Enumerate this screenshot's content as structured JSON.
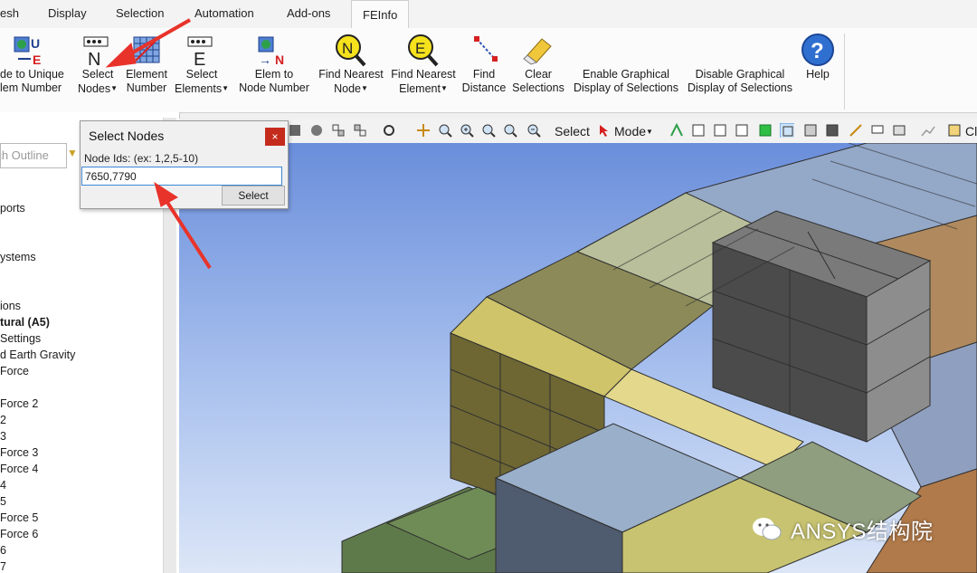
{
  "tabs": [
    "esh",
    "Display",
    "Selection",
    "Automation",
    "Add-ons",
    "FEInfo"
  ],
  "ribbon": {
    "node_to_unique_elem": [
      "de to Unique",
      "lem Number"
    ],
    "select_nodes": [
      "Select",
      "Nodes"
    ],
    "element_number": [
      "Element",
      "Number"
    ],
    "select_elements": [
      "Select",
      "Elements"
    ],
    "elem_to_node_number": [
      "Elem to",
      "Node Number"
    ],
    "find_nearest_node": [
      "Find Nearest",
      "Node"
    ],
    "find_nearest_element": [
      "Find Nearest",
      "Element"
    ],
    "find_distance": [
      "Find",
      "Distance"
    ],
    "clear_selections": [
      "Clear",
      "Selections"
    ],
    "enable_graphical": [
      "Enable Graphical",
      "Display of Selections"
    ],
    "disable_graphical": [
      "Disable Graphical",
      "Display of Selections"
    ],
    "help": "Help"
  },
  "outline": {
    "search_placeholder": "rch Outline",
    "items": [
      "ports",
      "ystems",
      "ions",
      "tural (A5)",
      "Settings",
      "d Earth Gravity",
      "Force",
      "Force 2",
      "2",
      "3",
      "Force 3",
      "Force 4",
      "4",
      "5",
      "Force 5",
      "Force 6",
      "6",
      "7"
    ]
  },
  "graphics_toolbar": {
    "select_label": "Select",
    "mode_label": "Mode",
    "cut_text": "Cl"
  },
  "dialog": {
    "title": "Select Nodes",
    "close": "×",
    "label": "Node Ids: (ex: 1,2,5-10)",
    "input_value": "7650,7790",
    "select_button": "Select"
  },
  "watermark": "ANSYS结构院",
  "colors": {
    "accent_arrow": "#e8332a",
    "dialog_close": "#c42b1c",
    "input_focus": "#3a87d8"
  }
}
